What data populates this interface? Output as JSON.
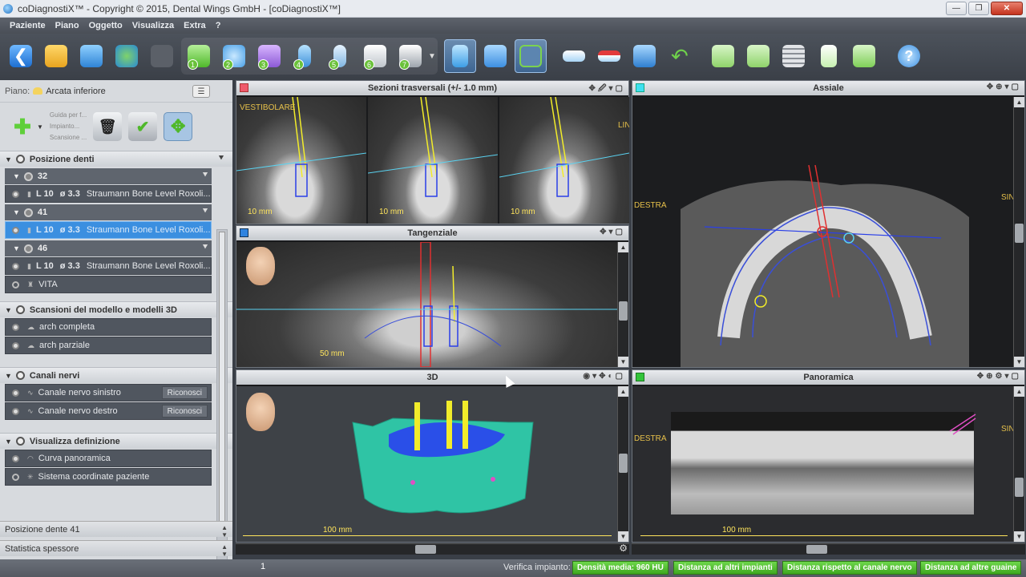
{
  "window": {
    "title": "coDiagnostiX™ - Copyright © 2015, Dental Wings GmbH - [coDiagnostiX™]"
  },
  "menu": [
    "Paziente",
    "Piano",
    "Oggetto",
    "Visualizza",
    "Extra",
    "?"
  ],
  "toolbar": {
    "numbered_steps": [
      "1",
      "2",
      "3",
      "4",
      "5",
      "6",
      "7"
    ]
  },
  "sidebar": {
    "plan_label": "Piano:",
    "plan_value": "Arcata inferiore",
    "action_list": [
      "Guida per f...",
      "Impianto...",
      "Scansione ..."
    ],
    "section_teeth": "Posizione denti",
    "teeth": [
      {
        "number": "32",
        "item_length": "L 10",
        "item_diameter": "ø 3.3",
        "item_name": "Straumann Bone Level Roxoli..."
      },
      {
        "number": "41",
        "item_length": "L 10",
        "item_diameter": "ø 3.3",
        "item_name": "Straumann Bone Level Roxoli..."
      },
      {
        "number": "46",
        "item_length": "L 10",
        "item_diameter": "ø 3.3",
        "item_name": "Straumann Bone Level Roxoli...",
        "extra": "VITA"
      }
    ],
    "section_models": "Scansioni del modello e modelli 3D",
    "models": [
      "arch completa",
      "arch parziale"
    ],
    "section_nerves": "Canali nervi",
    "nerves": [
      {
        "label": "Canale nervo sinistro",
        "button": "Riconosci"
      },
      {
        "label": "Canale nervo destro",
        "button": "Riconosci"
      }
    ],
    "section_display": "Visualizza definizione",
    "display_items": [
      "Curva panoramica",
      "Sistema coordinate paziente"
    ],
    "bottom_rows": [
      "Posizione dente 41",
      "Statistica spessore"
    ]
  },
  "views": {
    "cross": {
      "title": "Sezioni trasversali (+/- 1.0 mm)",
      "scale": "10 mm",
      "left_text": "VESTIBOLARE",
      "right_text": "LINGUALE"
    },
    "tangential": {
      "title": "Tangenziale",
      "scale": "50 mm"
    },
    "axial": {
      "title": "Assiale",
      "left_text": "DESTRA",
      "right_text": "SINISTRA"
    },
    "three_d": {
      "title": "3D",
      "scale": "100 mm"
    },
    "panoramic": {
      "title": "Panoramica",
      "scale": "100 mm",
      "left_text": "DESTRA",
      "right_text": "SINISTRA"
    }
  },
  "status": {
    "page": "1",
    "label": "Verifica impianto:",
    "badges": [
      "Densità media: 960 HU",
      "Distanza ad altri impianti",
      "Distanza rispetto al canale nervo",
      "Distanza ad altre guaine"
    ]
  },
  "colors": {
    "accent_blue": "#3b8fe0",
    "status_green": "#4ebf2b",
    "implant_yellow": "#f2ec2a",
    "implant_red": "#e03030",
    "model_cyan": "#2fc4a5",
    "model_blue": "#2a4fe8"
  }
}
